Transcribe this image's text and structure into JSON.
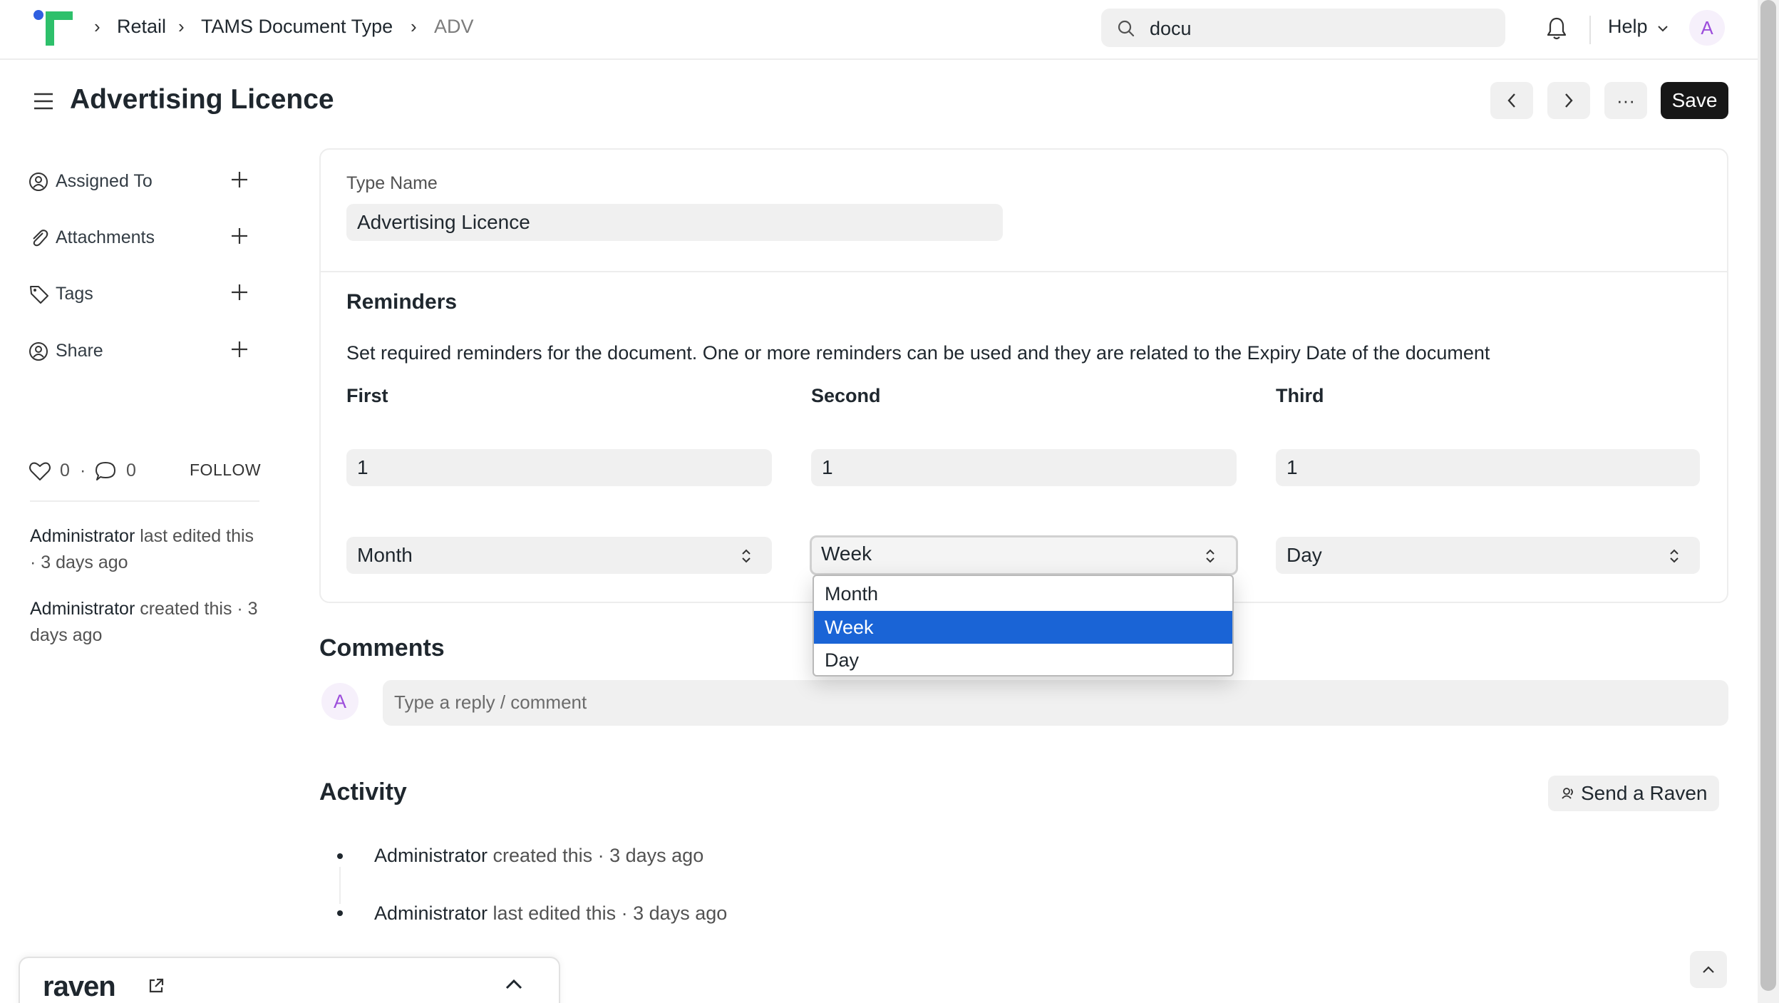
{
  "breadcrumbs": [
    "Retail",
    "TAMS Document Type",
    "ADV"
  ],
  "search": {
    "value": "docu"
  },
  "header": {
    "help_label": "Help",
    "avatar_initial": "A"
  },
  "page": {
    "title": "Advertising Licence",
    "more_label": "···",
    "save_label": "Save"
  },
  "sidebar": {
    "items": [
      {
        "label": "Assigned To"
      },
      {
        "label": "Attachments"
      },
      {
        "label": "Tags"
      },
      {
        "label": "Share"
      }
    ],
    "likes": "0",
    "comments_count": "0",
    "follow_label": "FOLLOW",
    "edited_user": "Administrator",
    "edited_text": " last edited this · 3 days ago",
    "created_user": "Administrator",
    "created_text": " created this · 3 days ago"
  },
  "form": {
    "type_name_label": "Type Name",
    "type_name_value": "Advertising Licence",
    "reminders_title": "Reminders",
    "reminders_desc": "Set required reminders for the document. One or more reminders can be used and they are related to the Expiry Date of the document",
    "columns": [
      {
        "heading": "First",
        "number": "1",
        "unit": "Month"
      },
      {
        "heading": "Second",
        "number": "1",
        "unit": "Week"
      },
      {
        "heading": "Third",
        "number": "1",
        "unit": "Day"
      }
    ],
    "dropdown_options": [
      "Month",
      "Week",
      "Day"
    ],
    "dropdown_selected": "Week"
  },
  "comments": {
    "title": "Comments",
    "avatar_initial": "A",
    "placeholder": "Type a reply / comment"
  },
  "activity": {
    "title": "Activity",
    "send_raven_label": "Send a Raven",
    "items": [
      {
        "user": "Administrator",
        "text": " created this · 3 days ago"
      },
      {
        "user": "Administrator",
        "text": " last edited this · 3 days ago"
      }
    ]
  },
  "raven_widget": {
    "logo": "raven"
  },
  "colors": {
    "accent": "#1a64d6",
    "save_button": "#171717",
    "logo_green": "#2ec06b",
    "logo_blue": "#2f5fe0",
    "avatar_text": "#9c4ddb"
  },
  "icons": [
    "frappe-logo",
    "chevron-right-icon",
    "search-icon",
    "bell-icon",
    "chevron-down-icon",
    "hamburger-icon",
    "chevron-left-icon",
    "more-icon",
    "assign-icon",
    "paperclip-icon",
    "tag-icon",
    "share-icon",
    "plus-icon",
    "heart-icon",
    "comment-icon",
    "select-arrows-icon",
    "raven-icon",
    "external-link-icon",
    "chevron-up-icon"
  ]
}
